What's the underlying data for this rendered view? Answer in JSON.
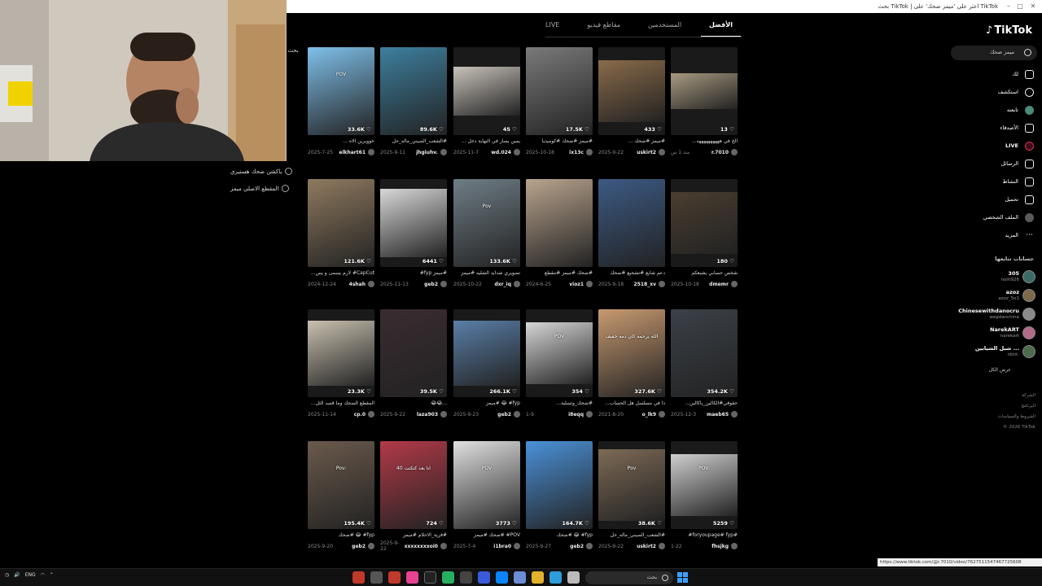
{
  "browser": {
    "title": "TikTok اعثر على 'ميمز ضحك' على | TikTok بحث"
  },
  "left_panel": {
    "suggestions": [
      "ياكشن ضحك هستيري",
      "المقطع الاصلي ميمز"
    ],
    "search_label": "بحث"
  },
  "tabs": [
    {
      "label": "الأفضل",
      "active": true
    },
    {
      "label": "المستخدمين",
      "active": false
    },
    {
      "label": "مقاطع فيديو",
      "active": false
    },
    {
      "label": "LIVE",
      "active": false
    }
  ],
  "results": [
    {
      "views": "33.6K",
      "caption": "خوويرين الاه ...",
      "date": "2025-7-25",
      "user": "elkhart61",
      "overlay": "POV",
      "color": "#7fc0ea"
    },
    {
      "views": "89.6K",
      "caption": "#الشعب_الصيني_ماله_حل",
      "date": "2025-9-11",
      "user": "jhgiuhv.",
      "overlay": "",
      "color": "#3d7f9e"
    },
    {
      "views": "45",
      "caption": "يمين يسار في النهاية دخل ...",
      "date": "2025-11-7",
      "user": "wd.024",
      "overlay": "",
      "color": "#c8c2ba"
    },
    {
      "views": "17.5K",
      "caption": "#ميمز #ضحك #كوميديا",
      "date": "2025-10-18",
      "user": "ix13c",
      "overlay": "",
      "color": "#7a7a7a"
    },
    {
      "views": "433",
      "caption": "#ميمز #ضحك ...",
      "date": "2025-9-22",
      "user": "uskirt2",
      "overlay": "",
      "color": "#8a6b4a"
    },
    {
      "views": "13",
      "caption": "الخ في ههههههههههه...",
      "date": "منذ 1 س",
      "user": "r.7010",
      "overlay": "",
      "color": "#a89a80"
    },
    {
      "views": "121.6K",
      "caption": "CapCut# لازم يسمى و يس...",
      "date": "2024-12-24",
      "user": "4shah",
      "overlay": "",
      "color": "#8f7a5f"
    },
    {
      "views": "6441",
      "caption": "#ميمز fyp#",
      "date": "2025-11-13",
      "user": "geb2",
      "overlay": "",
      "color": "#d8d8d8"
    },
    {
      "views": "133.6K",
      "caption": "تصويري شدايد الشليه #ميمز",
      "date": "2025-10-22",
      "user": "dxr_iq",
      "overlay": "Pov",
      "color": "#6f7d86"
    },
    {
      "views": "",
      "caption": "#ضحك #ميمز #مقطع",
      "date": "2024-6-25",
      "user": "vioz1",
      "overlay": "",
      "color": "#b9a48e"
    },
    {
      "views": "",
      "caption": "دعم شايع #تشجيع #ضحك",
      "date": "2025-9-18",
      "user": "2518_xv",
      "overlay": "",
      "color": "#3c5a84"
    },
    {
      "views": "180",
      "caption": "شخص حسابي بشبعكم",
      "date": "2025-10-18",
      "user": "dmemr",
      "overlay": "",
      "color": "#4a3e30"
    },
    {
      "views": "23.3K",
      "caption": "المقطع الضحك وما قصد الثل...",
      "date": "2025-11-14",
      "user": "cp.0",
      "overlay": "",
      "color": "#c9c1b0"
    },
    {
      "views": "39.5K",
      "caption": "...😂😂",
      "date": "2025-9-22",
      "user": "laza903",
      "overlay": "",
      "color": "#3a2c30"
    },
    {
      "views": "266.1K",
      "caption": "fyp# 😂 #ميمز",
      "date": "2025-9-23",
      "user": "geb2",
      "overlay": "",
      "color": "#5a7fa8"
    },
    {
      "views": "354",
      "caption": "#ضحك_وتسلية...",
      "date": "1-9",
      "user": "i8eqq",
      "overlay": "POV",
      "color": "#d6d6d6"
    },
    {
      "views": "327.6K",
      "caption": "ذا في مسلسل هل الحساب...",
      "date": "2021-8-20",
      "user": "o_lk9",
      "overlay": "الله يرحمه كان دمه خفيف",
      "color": "#c89a70"
    },
    {
      "views": "354.2K",
      "caption": "حقوقي#الكالين_ياكالين...",
      "date": "2025-12-3",
      "user": "maeb65",
      "overlay": "",
      "color": "#3b4148"
    },
    {
      "views": "195.4K",
      "caption": "fyp# 😂 #ضحك",
      "date": "2025-9-20",
      "user": "geb2",
      "overlay": "Pov:",
      "color": "#6b5a4c"
    },
    {
      "views": "724",
      "caption": "#قرية_الاحلام #ميمز",
      "date": "2025-9-22",
      "user": "xxxxxxxxoi0",
      "overlay": "انا بعد كتكتت 40",
      "color": "#b23a48"
    },
    {
      "views": "3773",
      "caption": "POV# #ضحك #ميمز",
      "date": "2025-7-4",
      "user": "i1bra0",
      "overlay": "POV",
      "color": "#e0e0e0"
    },
    {
      "views": "164.7K",
      "caption": "fyp# 😂 #ضحك",
      "date": "2025-9-27",
      "user": "geb2",
      "overlay": "",
      "color": "#4b91d8"
    },
    {
      "views": "38.6K",
      "caption": "#الشعب_الصيني_ماله_حل",
      "date": "2025-9-22",
      "user": "uskirt2",
      "overlay": "Pov",
      "color": "#7d6a56"
    },
    {
      "views": "5259",
      "caption": "#foryoupage# fyp#",
      "date": "1-22",
      "user": "fhsjkg",
      "overlay": "POV:",
      "color": "#cfcfcf"
    }
  ],
  "sidebar": {
    "logo": "TikTok",
    "search_text": "ميمز ضحك",
    "nav": [
      {
        "label": "لك",
        "icon": "home-icon"
      },
      {
        "label": "استكشف",
        "icon": "compass-icon"
      },
      {
        "label": "تابعته",
        "icon": "following-icon"
      },
      {
        "label": "الأصدقاء",
        "icon": "friends-icon"
      },
      {
        "label": "LIVE",
        "icon": "live-icon"
      },
      {
        "label": "الرسائل",
        "icon": "messages-icon"
      },
      {
        "label": "النشاط",
        "icon": "activity-icon"
      },
      {
        "label": "تحميل",
        "icon": "upload-icon"
      },
      {
        "label": "الملف الشخصي",
        "icon": "profile-icon"
      },
      {
        "label": "المزيد",
        "icon": "more-icon"
      }
    ],
    "following_title": "حسابات تتابعها",
    "following": [
      {
        "name": "305",
        "handle": "nolit926"
      },
      {
        "name": "azoz",
        "handle": "azoz_5o1"
      },
      {
        "name": "Chinesewithdanocru",
        "handle": "wegdanchina"
      },
      {
        "name": "NarekART",
        "handle": "narekart"
      },
      {
        "name": "شبل الشيابين ...",
        "handle": "nbnt."
      }
    ],
    "see_more": "عرض الكل",
    "footer": [
      "الشركة",
      "البرنامج",
      "الشروط والسياسات",
      "© 2026 TikTok"
    ]
  },
  "status_url": "https://www.tiktok.com/@r.7010/video/7627511547467725608",
  "taskbar": {
    "lang": "ENG",
    "search": "بحث"
  }
}
